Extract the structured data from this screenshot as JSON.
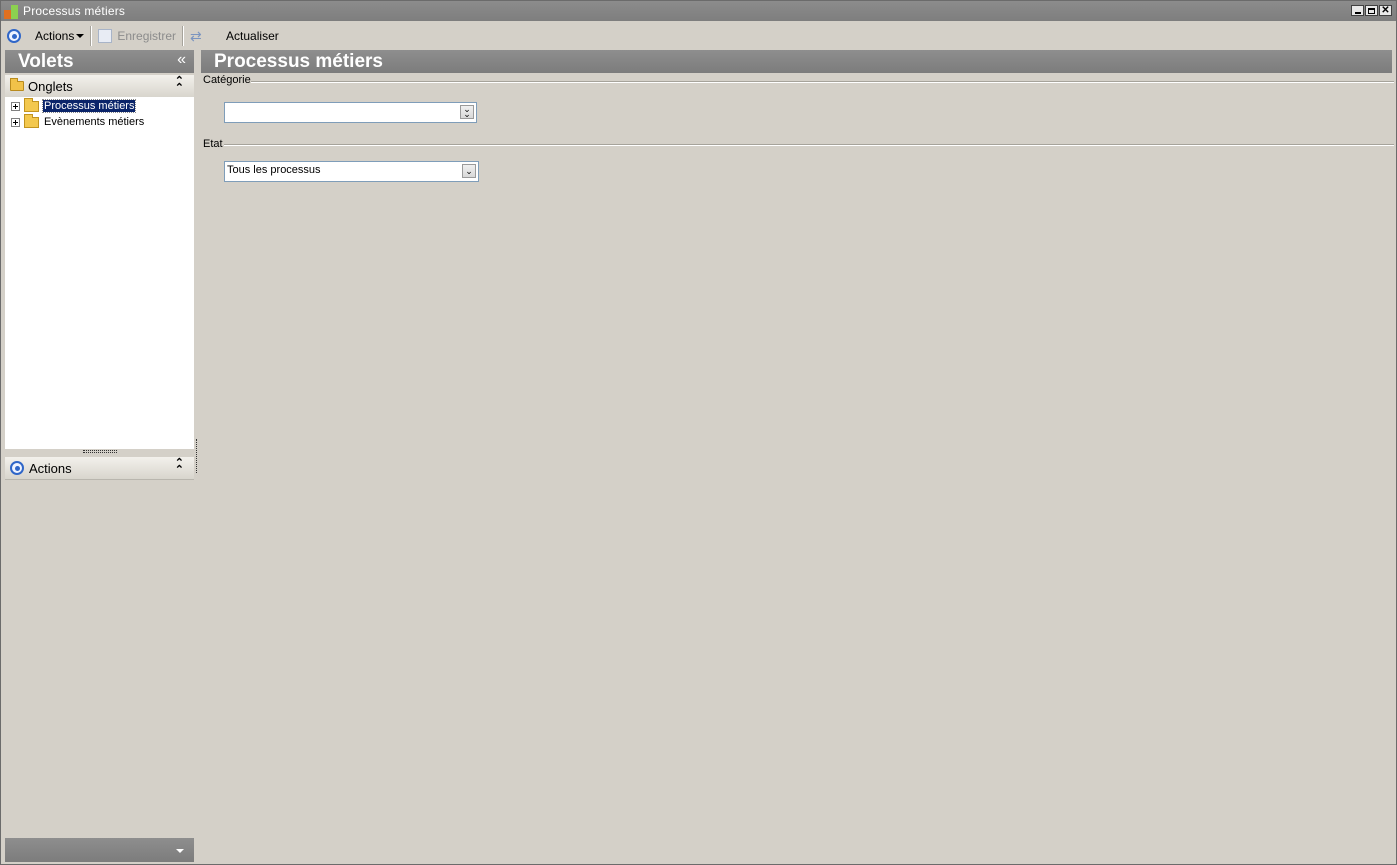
{
  "window": {
    "title": "Processus métiers"
  },
  "toolbar": {
    "actions_label": "Actions",
    "save_label": "Enregistrer",
    "refresh_label": "Actualiser"
  },
  "left_panel": {
    "title": "Volets",
    "collapse_glyph": "«",
    "tabs_section": {
      "label": "Onglets",
      "items": [
        {
          "label": "Processus métiers",
          "selected": true
        },
        {
          "label": "Evènements métiers",
          "selected": false
        }
      ]
    },
    "actions_section": {
      "label": "Actions"
    }
  },
  "main": {
    "title": "Processus métiers",
    "categorie": {
      "label": "Catégorie",
      "value": ""
    },
    "etat": {
      "label": "Etat",
      "value": "Tous les processus"
    }
  },
  "colors": {
    "header_gray": "#7e7e7e",
    "background": "#d4d0c8",
    "selection": "#0a246a",
    "icon_blue": "#2f66c8"
  }
}
